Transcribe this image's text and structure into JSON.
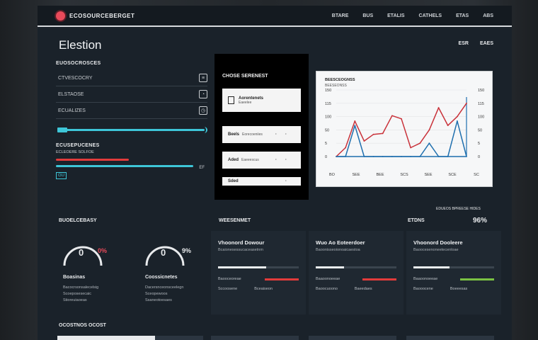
{
  "header": {
    "brand": "ECOSOURCEBERGET",
    "nav": [
      "BTARE",
      "BUS",
      "ETALIS",
      "CATHELS",
      "ETAS",
      "ABS"
    ]
  },
  "page": {
    "title": "Elestion",
    "actions": [
      "ESR",
      "EAES"
    ]
  },
  "left_panel": {
    "section_title": "EUOSOCROSCES",
    "rows": [
      {
        "label": "CTVESCOCRY",
        "icon": "document-icon"
      },
      {
        "label": "ELSTAOSE",
        "icon": "user-icon"
      },
      {
        "label": "ECUALIZES",
        "icon": "clock-icon"
      }
    ],
    "slider_tag": "EQ",
    "section2_title": "ECUSEPUCENES",
    "section2_sub": "ECLEOERE SOLFOE",
    "bar_end": "EF",
    "badge": "GU"
  },
  "card_panel": {
    "title": "CHOSE SERENEST",
    "cards": [
      {
        "label": "Aorentenets",
        "sub": "Eaeelee"
      },
      {
        "label": "Beels",
        "sub": "Eorecoeniies"
      },
      {
        "label": "Aded",
        "sub": "Eaeeescus"
      },
      {
        "label": "Sded",
        "sub": ""
      }
    ]
  },
  "chart_data": {
    "type": "line",
    "title": "BEESCEOGNSS",
    "subtitle": "BEESEONSS",
    "yticks": [
      "150",
      "115",
      "100",
      "50",
      "5",
      "0"
    ],
    "xticks": [
      "BO",
      "SEE",
      "BEE",
      "SCS",
      "SEE",
      "SCE",
      "SC"
    ],
    "series": [
      {
        "color": "#c9323a",
        "values": [
          0,
          20,
          80,
          35,
          50,
          52,
          92,
          85,
          20,
          30,
          60,
          110,
          70,
          90,
          120
        ]
      },
      {
        "color": "#1f6fae",
        "values": [
          0,
          0,
          70,
          0,
          0,
          0,
          0,
          0,
          0,
          0,
          30,
          0,
          0,
          80,
          0
        ]
      }
    ],
    "ylim": [
      0,
      150
    ]
  },
  "band": {
    "left_title": "BUOELCEBASY",
    "center_title": "WEESENMET",
    "right_note": "EDUEOS BPREESE HIDES",
    "right_title": "ETDNS",
    "right_value": "96%"
  },
  "gauges": [
    {
      "value": "0",
      "percent": "0%",
      "title": "Boasinas",
      "lines": [
        "Bacocrsonsalecelsig",
        "Scoeposesecaic",
        "Stioreuiaoeas"
      ],
      "color": "#e84a5a"
    },
    {
      "value": "0",
      "percent": "9%",
      "title": "Coossicnetes",
      "lines": [
        "Dacersnceonsceelegn",
        "Sceopewoos",
        "Ssaneotoesaes"
      ],
      "color": "#e8eaec"
    }
  ],
  "stat_cards": [
    {
      "title": "Vhoonord Dowour",
      "sub": "Bcaionesessucaceasetnm",
      "progress": 0.6,
      "row_label": "Baooceoreae",
      "accent": "#e23b3b",
      "foot": [
        "Sccoosene",
        "Bceaiseon"
      ]
    },
    {
      "title": "Wuo Ao Eoteerdoer",
      "sub": "Baoonisseoionoaicaestoa",
      "progress": 0.35,
      "row_label": "Baaoonoeeae",
      "accent": "#e23b3b",
      "foot": [
        "Baoocuoono",
        "Baeedaes"
      ]
    },
    {
      "title": "Vhoonord Dooleere",
      "sub": "Baoocesenoneetecenloae",
      "progress": 0.45,
      "row_label": "Baaoonoeeae",
      "accent": "#7ac143",
      "foot": [
        "Baooocene",
        "Boeeesas"
      ]
    }
  ],
  "footer": {
    "title": "OCOSTNOS OCOST"
  }
}
